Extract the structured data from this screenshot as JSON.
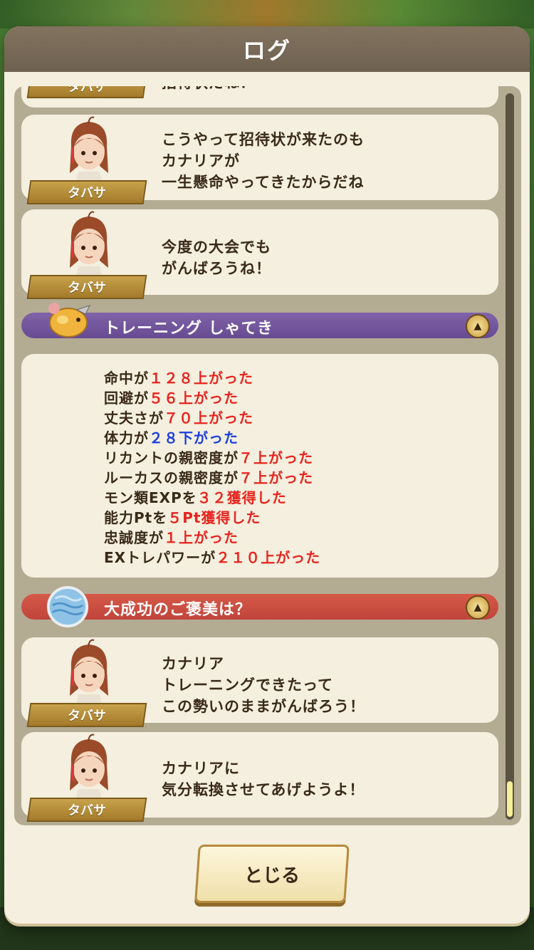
{
  "modal": {
    "title": "ログ"
  },
  "close_button": {
    "label": "とじる"
  },
  "colors": {
    "up": "#e8231e",
    "down": "#1a3ee0",
    "training_header": "#7a5ca2",
    "reward_header": "#cf5244"
  },
  "log": {
    "entries_top": [
      {
        "speaker": "タバサ",
        "lines": [
          "招待状だね？"
        ]
      },
      {
        "speaker": "タバサ",
        "lines": [
          "こうやって招待状が来たのも",
          "カナリアが",
          "一生懸命やってきたからだね"
        ]
      },
      {
        "speaker": "タバサ",
        "lines": [
          "今度の大会でも",
          "がんばろうね！"
        ]
      }
    ],
    "training_section": {
      "title": "トレーニング しゃてき",
      "icon": "bird-icon"
    },
    "stats": [
      {
        "pre": "命中が",
        "num": "１２８",
        "post": "上がった",
        "dir": "up"
      },
      {
        "pre": "回避が",
        "num": "５６",
        "post": "上がった",
        "dir": "up"
      },
      {
        "pre": "丈夫さが",
        "num": "７０",
        "post": "上がった",
        "dir": "up"
      },
      {
        "pre": "体力が",
        "num": "２８",
        "post": "下がった",
        "dir": "down"
      },
      {
        "pre": "リカントの親密度が",
        "num": "７",
        "post": "上がった",
        "dir": "up"
      },
      {
        "pre": "ルーカスの親密度が",
        "num": "７",
        "post": "上がった",
        "dir": "up"
      },
      {
        "pre": "モン類EXPを",
        "num": "３２",
        "post": "獲得した",
        "dir": "up"
      },
      {
        "pre": "能力Ptを",
        "num": "５Pt",
        "post": "獲得した",
        "dir": "up"
      },
      {
        "pre": "忠誠度が",
        "num": "１",
        "post": "上がった",
        "dir": "up"
      },
      {
        "pre": "EXトレパワーが",
        "num": "２１０",
        "post": "上がった",
        "dir": "up"
      }
    ],
    "reward_section": {
      "title": "大成功のご褒美は？",
      "icon": "water-orb-icon"
    },
    "entries_bottom": [
      {
        "speaker": "タバサ",
        "lines": [
          "カナリア",
          "トレーニングできたって",
          "この勢いのままがんばろう！"
        ]
      },
      {
        "speaker": "タバサ",
        "lines": [
          "カナリアに",
          "気分転換させてあげようよ！"
        ]
      }
    ]
  }
}
